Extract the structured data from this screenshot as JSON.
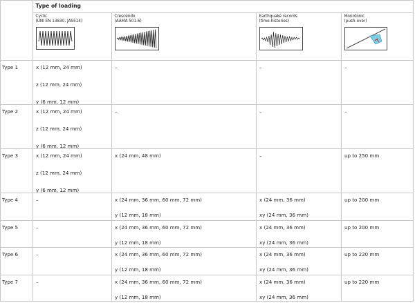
{
  "header": {
    "title": "Type of loading",
    "loadings": [
      {
        "name_line1": "Cyclic",
        "name_line2": "(UNI EN 13830, JAS514)",
        "icon": "cyclic-waveform-icon"
      },
      {
        "name_line1": "Crescendo",
        "name_line2": "(AAMA 501.6)",
        "icon": "crescendo-waveform-icon"
      },
      {
        "name_line1": "Earthquake records",
        "name_line2": "(time-histories)",
        "icon": "earthquake-record-icon"
      },
      {
        "name_line1": "Monotonic",
        "name_line2": "(push-over)",
        "icon": "monotonic-pushover-icon"
      }
    ]
  },
  "rows": [
    {
      "label": "Type 1",
      "cyclic": [
        "x (12 mm, 24 mm)",
        "z (12 mm, 24 mm)",
        "y (6 mm, 12 mm)"
      ],
      "crescendo": [
        "–"
      ],
      "earthquake": [
        "–"
      ],
      "monotonic": [
        "–"
      ]
    },
    {
      "label": "Type 2",
      "cyclic": [
        "x (12 mm, 24 mm)",
        "z (12 mm, 24 mm)",
        "y (6 mm, 12 mm)"
      ],
      "crescendo": [
        "–"
      ],
      "earthquake": [
        "–"
      ],
      "monotonic": [
        "–"
      ]
    },
    {
      "label": "Type 3",
      "cyclic": [
        "x (12 mm, 24 mm)",
        "z (12 mm, 24 mm)",
        "y (6 mm, 12 mm)"
      ],
      "crescendo": [
        "x (24 mm, 48 mm)"
      ],
      "earthquake": [
        "–"
      ],
      "monotonic": [
        "up to 250 mm"
      ]
    },
    {
      "label": "Type 4",
      "cyclic": [
        "–"
      ],
      "crescendo": [
        "x (24 mm, 36 mm, 60 mm, 72 mm)",
        "y (12 mm, 18 mm)"
      ],
      "earthquake": [
        "x (24 mm, 36 mm)",
        "xy (24 mm, 36 mm)"
      ],
      "monotonic": [
        "up to 200 mm"
      ]
    },
    {
      "label": "Type 5",
      "cyclic": [
        "–"
      ],
      "crescendo": [
        "x (24 mm, 36 mm, 60 mm, 72 mm)",
        "y (12 mm, 18 mm)"
      ],
      "earthquake": [
        "x (24 mm, 36 mm)",
        "xy (24 mm, 36 mm)"
      ],
      "monotonic": [
        "up to 200 mm"
      ]
    },
    {
      "label": "Type 6",
      "cyclic": [
        "–"
      ],
      "crescendo": [
        "x (24 mm, 36 mm, 60 mm, 72 mm)",
        "y (12 mm, 18 mm)"
      ],
      "earthquake": [
        "x (24 mm, 36 mm)",
        "xy (24 mm, 36 mm)"
      ],
      "monotonic": [
        "up to 220 mm"
      ]
    },
    {
      "label": "Type 7",
      "cyclic": [
        "–"
      ],
      "crescendo": [
        "x (24 mm, 36 mm, 60 mm, 72 mm)",
        "y (12 mm, 18 mm)"
      ],
      "earthquake": [
        "x (24 mm, 36 mm)",
        "xy (24 mm, 36 mm)"
      ],
      "monotonic": [
        "up to 220 mm"
      ]
    }
  ]
}
